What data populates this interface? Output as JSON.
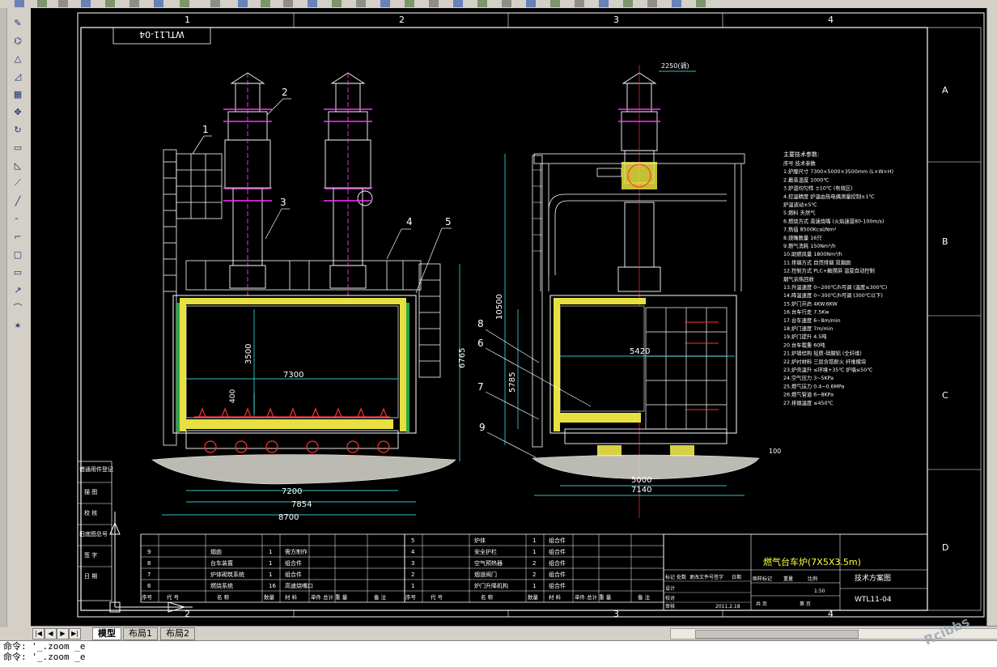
{
  "drawing": {
    "title_block": {
      "drawing_name": "燃气台车炉(7X5X3.5m)",
      "drawing_no": "WTL11-04",
      "mirror_label": "WTL11-04",
      "phase": "技术方案图",
      "scale": "1:50",
      "date": "2011.2.18"
    },
    "zone_cols": [
      "1",
      "2",
      "3",
      "4"
    ],
    "zone_rows": [
      "A",
      "B",
      "C",
      "D"
    ],
    "dims": {
      "d7300": "7300",
      "d3500": "3500",
      "d400": "400",
      "d6765": "6765",
      "d7200": "7200",
      "d7854": "7854",
      "d8700": "8700",
      "d10500": "10500",
      "d5420": "5420",
      "d5785": "5785",
      "d5000": "5000",
      "d7140": "7140",
      "d2250": "2250(调)",
      "d100": "100"
    },
    "callouts_left": [
      "1",
      "2",
      "3",
      "4",
      "5"
    ],
    "callouts_right": [
      "8",
      "6",
      "7",
      "9"
    ],
    "notes_title": "主要技术参数:",
    "notes": [
      "序号          技术参数",
      "1.炉膛尺寸     7300×5000×3500mm (L×W×H)",
      "2.最高温度     1000℃",
      "3.炉温均匀性   ±10℃ (有效区)",
      "4.控温精度     炉温由热电偶测量控制±1℃",
      "               炉温波动±5℃",
      "5.燃料         天然气",
      "6.燃烧方式     高速烧嘴 (火焰速度80-100m/s)",
      "7.热值         8500Kcal/Nm³",
      "8.烧嘴数量     16只",
      "9.燃气消耗     150Nm³/h",
      "10.助燃风量    1800Nm³/h",
      "11.排烟方式    自然排烟 双烟囱",
      "12.控制方式    PLC+触摸屏 温度自动控制",
      "               烟气余热回收",
      "13.升温速度    0~200℃/h可调 (温度≤300℃)",
      "14.降温速度    0~300℃/h可调 (300℃以下)",
      "15.炉门开启    4KW.6KW",
      "16.台车行走    7.5Kw",
      "17.台车速度    6~8m/min",
      "18.炉门速度    7m/min",
      "19.炉门提升    4.5吨",
      "20.台车载重    60吨",
      "21.炉墙结构    轻质-硅酸铝 (全纤维)",
      "22.炉衬材料    三层含锆耐火 纤维模块",
      "23.炉壳温升    ≤环境+35℃ 炉墙≤50℃",
      "24.空气压力    3~5KPa",
      "25.燃气压力    0.4~0.6MPa",
      "26.燃气管道    6~8KPa",
      "27.排烟温度    ≤450℃"
    ],
    "bom_left": [
      {
        "no": "9",
        "name": "烟囱",
        "qty": "1",
        "mat": "需方制作"
      },
      {
        "no": "8",
        "name": "台车装置",
        "qty": "1",
        "mat": "组合件"
      },
      {
        "no": "7",
        "name": "炉体砌筑系统",
        "qty": "1",
        "mat": "组合件"
      },
      {
        "no": "6",
        "name": "燃烧系统",
        "qty": "16",
        "mat": "高速烧嘴口"
      }
    ],
    "bom_right": [
      {
        "no": "5",
        "name": "炉体",
        "qty": "1",
        "mat": "组合件"
      },
      {
        "no": "4",
        "name": "安全护栏",
        "qty": "1",
        "mat": "组合件"
      },
      {
        "no": "3",
        "name": "空气预热器",
        "qty": "2",
        "mat": "组合件"
      },
      {
        "no": "2",
        "name": "烟道阀门",
        "qty": "2",
        "mat": "组合件"
      },
      {
        "no": "1",
        "name": "炉门升降机构",
        "qty": "1",
        "mat": "组合件"
      }
    ],
    "bom_header": [
      "序号",
      "代  号",
      "名    称",
      "数量",
      "材  料",
      "单件 总计 重  量",
      "备  注"
    ],
    "left_stamp": [
      "借通用件登记",
      "描  图",
      "校  核",
      "旧底图总号",
      "签  字",
      "日  期"
    ],
    "title_sub": [
      "标记",
      "处数",
      "更改文件号",
      "签字",
      "日期",
      "设计",
      "校对",
      "审核",
      "工艺",
      "批准"
    ],
    "title_mid": [
      "图样标记",
      "重量",
      "比例",
      "共  页",
      "第  页"
    ]
  },
  "tabs": [
    "模型",
    "布局1",
    "布局2"
  ],
  "command_lines": [
    "命令: '_.zoom _e",
    "命令: '_.zoom _e"
  ],
  "watermark": "Rcibbs"
}
